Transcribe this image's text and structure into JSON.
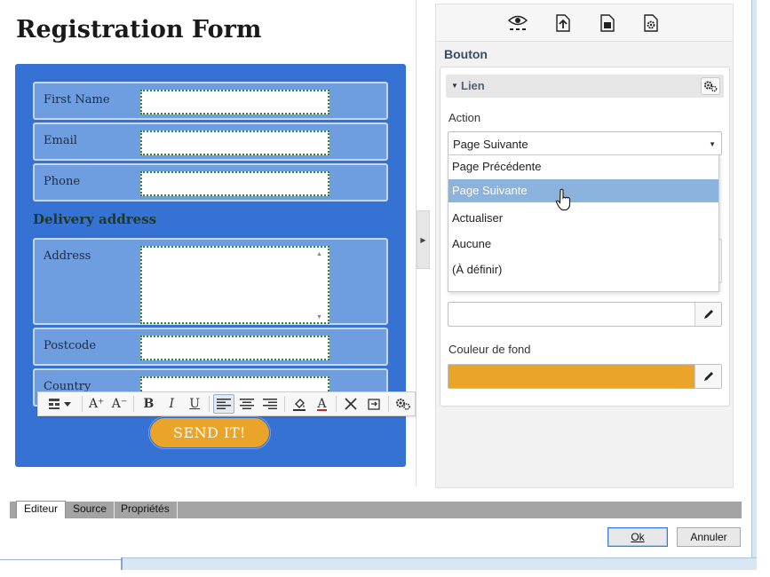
{
  "form": {
    "title": "Registration Form",
    "fields": [
      {
        "label": "First Name"
      },
      {
        "label": "Email"
      },
      {
        "label": "Phone"
      }
    ],
    "section_title": "Delivery address",
    "address_fields": [
      {
        "label": "Address"
      },
      {
        "label": "Postcode"
      },
      {
        "label": "Country"
      }
    ],
    "submit_label": "SEND IT!",
    "submit_color": "#eba42a",
    "background_color": "#3572d4"
  },
  "floating_toolbar": {
    "items": [
      "table-icon",
      "font-size-increase-icon",
      "font-size-decrease-icon",
      "bold-icon",
      "italic-icon",
      "underline-icon",
      "align-left-icon",
      "align-center-icon",
      "align-right-icon",
      "fill-color-icon",
      "text-color-icon",
      "cut-icon",
      "insert-icon",
      "settings-icon"
    ],
    "active": "align-left-icon",
    "glyphs": {
      "increase": "A⁺",
      "decrease": "A⁻",
      "bold": "B",
      "italic": "I",
      "underline": "U",
      "text_color": "A"
    }
  },
  "panel": {
    "toolbar_icons": [
      "preview-eye-icon",
      "page-up-icon",
      "page-info-icon",
      "page-settings-icon"
    ],
    "heading": "Bouton",
    "section": "Lien",
    "action_label": "Action",
    "action_value": "Page Suivante",
    "action_options": [
      "Page Précédente",
      "Page Suivante",
      "Actualiser",
      "Aucune",
      "(À définir)"
    ],
    "selected_index": 1,
    "bg_color_label": "Couleur de fond",
    "bg_color_value": "#eba42a"
  },
  "tabs": [
    {
      "label": "Editeur",
      "active": true
    },
    {
      "label": "Source",
      "active": false
    },
    {
      "label": "Propriétés",
      "active": false
    }
  ],
  "buttons": {
    "ok": "Ok",
    "cancel": "Annuler"
  }
}
